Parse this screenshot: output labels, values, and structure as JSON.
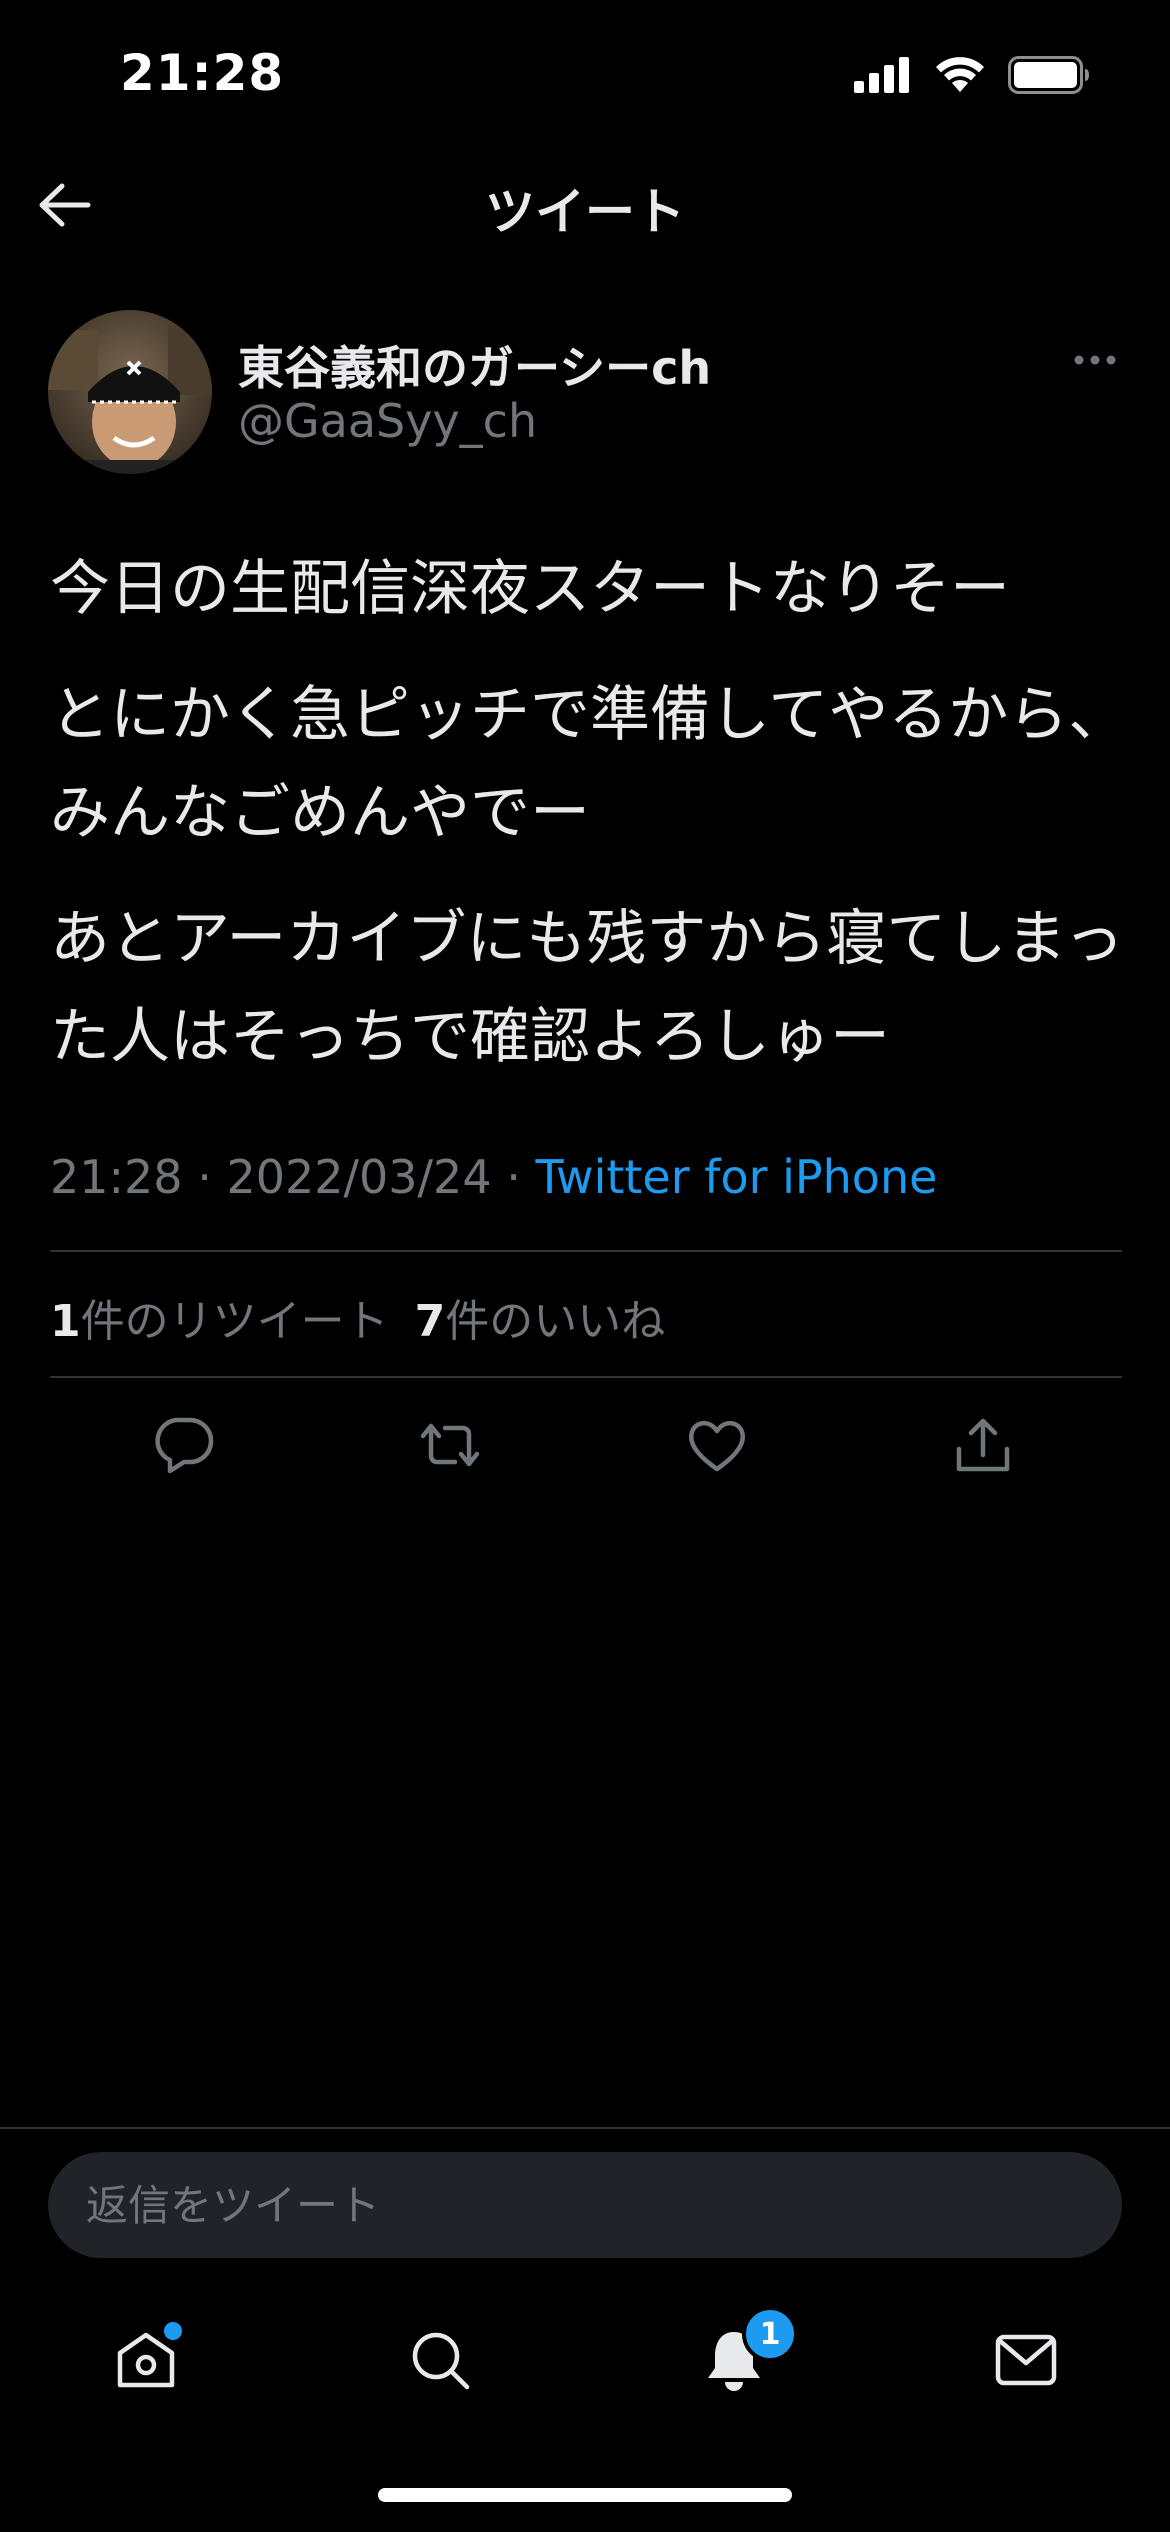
{
  "status_bar": {
    "time": "21:28"
  },
  "header": {
    "title": "ツイート"
  },
  "author": {
    "name": "東谷義和のガーシーch",
    "handle": "@GaaSyy_ch"
  },
  "tweet": {
    "paragraphs": [
      "今日の生配信深夜スタートなりそー",
      "とにかく急ピッチで準備してやるから、みんなごめんやでー",
      "あとアーカイブにも残すから寝てしまった人はそっちで確認よろしゅー"
    ],
    "time": "21:28",
    "date": "2022/03/24",
    "separator": "·",
    "source": "Twitter for iPhone"
  },
  "stats": {
    "retweets_count": "1",
    "retweets_label": "件のリツイート",
    "likes_count": "7",
    "likes_label": "件のいいね"
  },
  "actions": [
    {
      "name": "reply-icon"
    },
    {
      "name": "retweet-icon"
    },
    {
      "name": "like-icon"
    },
    {
      "name": "share-icon"
    }
  ],
  "reply": {
    "placeholder": "返信をツイート"
  },
  "tab_bar": {
    "tabs": [
      {
        "name": "home-icon",
        "has_dot": true
      },
      {
        "name": "search-icon"
      },
      {
        "name": "notifications-icon",
        "badge": "1"
      },
      {
        "name": "messages-icon"
      }
    ]
  },
  "colors": {
    "background": "#000000",
    "text": "#e7e9ea",
    "secondary_text": "#71767b",
    "accent": "#1d9bf0",
    "divider": "#2f3336"
  }
}
